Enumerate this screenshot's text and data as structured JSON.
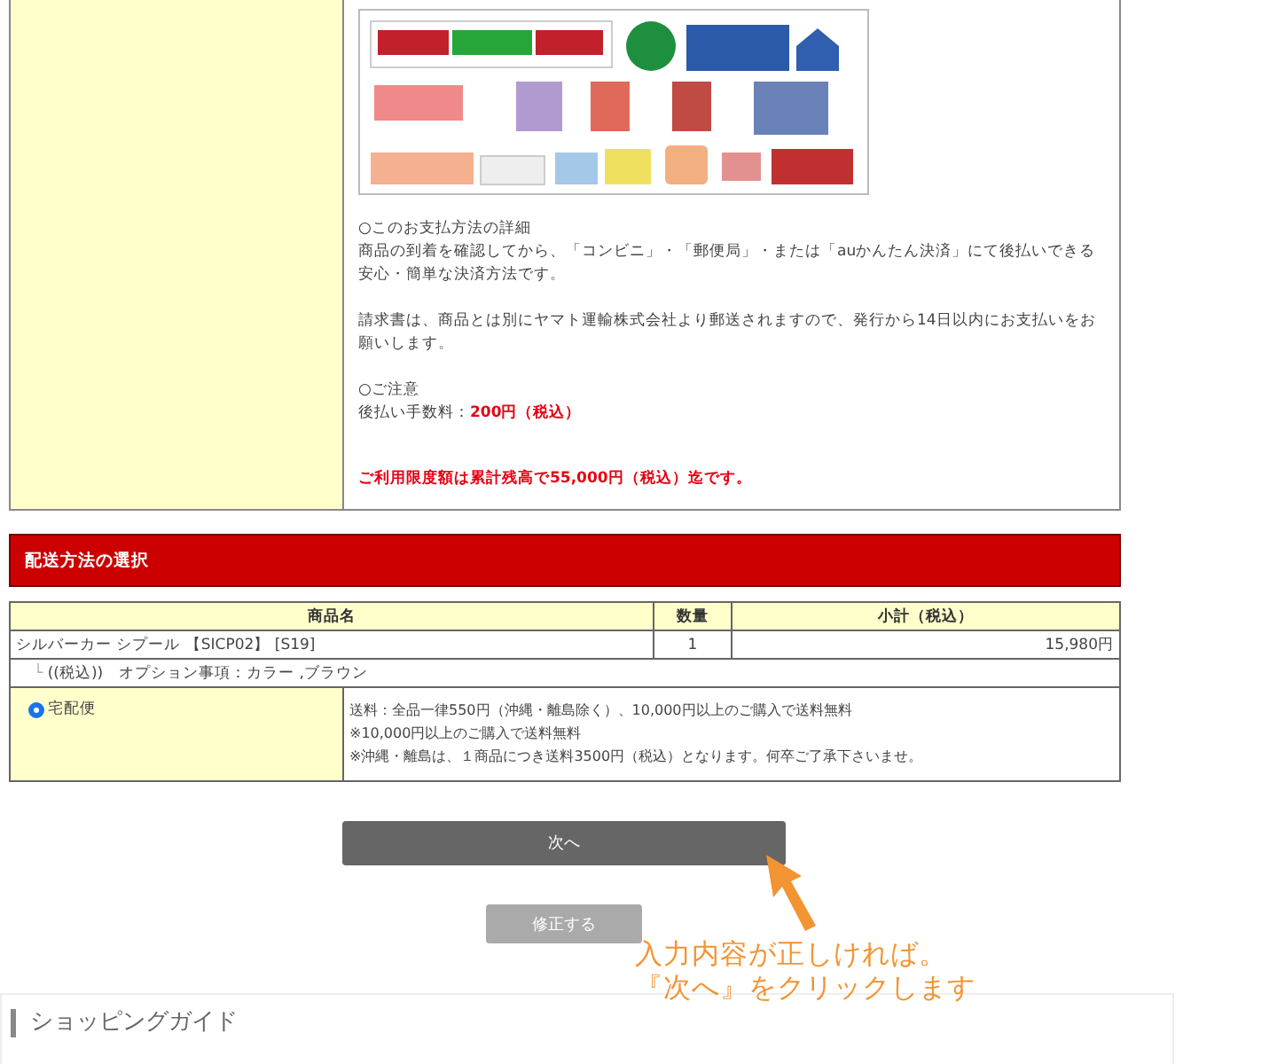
{
  "payment_detail": {
    "paragraphs": [
      {
        "kind": "plain",
        "lines": [
          "○このお支払方法の詳細",
          "商品の到着を確認してから、「コンビニ」・「郵便局」・または「auかんたん決済」にて後払いできる安心・簡単な決済方法です。"
        ]
      },
      {
        "kind": "plain",
        "lines": [
          "請求書は、商品とは別にヤマト運輸株式会社より郵送されますので、発行から14日以内にお支払いをお願いします。"
        ]
      },
      {
        "kind": "plain",
        "lines": [
          "○ご注意",
          "後払い手数料：**200円（税込）**"
        ]
      },
      {
        "kind": "alert",
        "lines": [
          "ご利用限度額は累計残高で55,000円（税込）迄です。"
        ]
      }
    ]
  },
  "section_header": "配送方法の選択",
  "table": {
    "columns": [
      "商品名",
      "数量",
      "小計（税込）"
    ],
    "rows": [
      {
        "name": "シルバーカー シプール 【SICP02】 [S19]",
        "quantity": "1",
        "subtotal": "15,980円"
      }
    ],
    "option_row": {
      "marker": "└",
      "text": "((税込))　オプション事項：カラー ,ブラウン"
    }
  },
  "delivery_options": [
    {
      "label": "宅配便",
      "selected": true,
      "notes": [
        "送料：全品一律550円（沖縄・離島除く）、10,000円以上のご購入で送料無料",
        "※10,000円以上のご購入で送料無料",
        "※沖縄・離島は、１商品につき送料3500円（税込）となります。何卒ご了承下さいませ。"
      ]
    }
  ],
  "buttons": [
    {
      "label": "次へ",
      "kind": "primary"
    },
    {
      "label": "修正する",
      "kind": "secondary"
    }
  ],
  "annotation": {
    "lines": [
      "入力内容が正しければ。",
      "『次へ』をクリックします"
    ]
  },
  "guide": {
    "title": "ショッピングガイド"
  }
}
